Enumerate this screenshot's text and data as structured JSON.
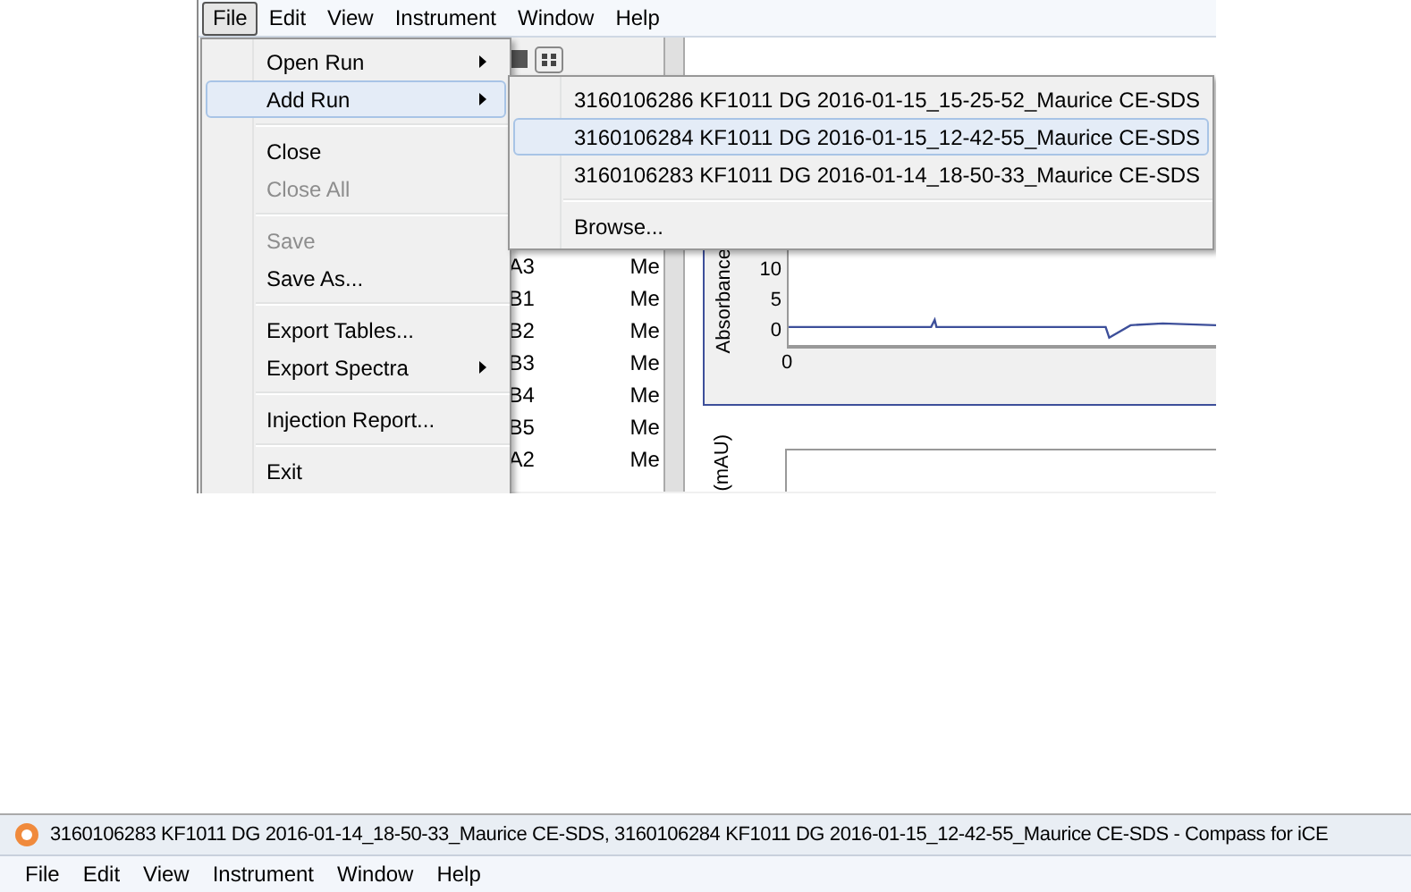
{
  "top_window": {
    "menu_bar": [
      {
        "label": "File",
        "selected": true
      },
      {
        "label": "Edit",
        "selected": false
      },
      {
        "label": "View",
        "selected": false
      },
      {
        "label": "Instrument",
        "selected": false
      },
      {
        "label": "Window",
        "selected": false
      },
      {
        "label": "Help",
        "selected": false
      }
    ],
    "table": {
      "rows": [
        {
          "column_1": "A3",
          "column_2": "Me"
        },
        {
          "column_1": "B1",
          "column_2": "Me"
        },
        {
          "column_1": "B2",
          "column_2": "Me"
        },
        {
          "column_1": "B3",
          "column_2": "Me"
        },
        {
          "column_1": "B4",
          "column_2": "Me"
        },
        {
          "column_1": "B5",
          "column_2": "Me"
        },
        {
          "column_1": "A2",
          "column_2": "Me"
        }
      ]
    },
    "chart": {
      "ylabel": "Absorbance",
      "yticks": [
        "10",
        "5",
        "0"
      ],
      "xticks": [
        "0"
      ]
    },
    "chart_2": {
      "ylabel": "(mAU)"
    },
    "file_menu": {
      "sections": [
        [
          {
            "label": "Open Run",
            "disabled": false,
            "selected": false,
            "submenu": true
          },
          {
            "label": "Add Run",
            "disabled": false,
            "selected": true,
            "submenu": true
          }
        ],
        [
          {
            "label": "Close",
            "disabled": false,
            "selected": false,
            "submenu": false
          },
          {
            "label": "Close All",
            "disabled": true,
            "selected": false,
            "submenu": false
          }
        ],
        [
          {
            "label": "Save",
            "disabled": true,
            "selected": false,
            "submenu": false
          },
          {
            "label": "Save As...",
            "disabled": false,
            "selected": false,
            "submenu": false
          }
        ],
        [
          {
            "label": "Export Tables...",
            "disabled": false,
            "selected": false,
            "submenu": false
          },
          {
            "label": "Export Spectra",
            "disabled": false,
            "selected": false,
            "submenu": true
          }
        ],
        [
          {
            "label": "Injection Report...",
            "disabled": false,
            "selected": false,
            "submenu": false
          }
        ],
        [
          {
            "label": "Exit",
            "disabled": false,
            "selected": false,
            "submenu": false
          }
        ]
      ]
    },
    "add_run_submenu": {
      "sections": [
        [
          {
            "label": "3160106286 KF1011 DG 2016-01-15_15-25-52_Maurice CE-SDS",
            "selected": false
          },
          {
            "label": "3160106284 KF1011 DG 2016-01-15_12-42-55_Maurice CE-SDS",
            "selected": true
          },
          {
            "label": "3160106283 KF1011 DG 2016-01-14_18-50-33_Maurice CE-SDS",
            "selected": false
          }
        ],
        [
          {
            "label": "Browse...",
            "selected": false
          }
        ]
      ]
    }
  },
  "bottom_window": {
    "title": "3160106283 KF1011 DG 2016-01-14_18-50-33_Maurice CE-SDS, 3160106284 KF1011 DG 2016-01-15_12-42-55_Maurice CE-SDS - Compass for iCE",
    "menu_bar": [
      {
        "label": "File",
        "selected": false
      },
      {
        "label": "Edit",
        "selected": false
      },
      {
        "label": "View",
        "selected": false
      },
      {
        "label": "Instrument",
        "selected": false
      },
      {
        "label": "Window",
        "selected": false
      },
      {
        "label": "Help",
        "selected": false
      }
    ]
  }
}
